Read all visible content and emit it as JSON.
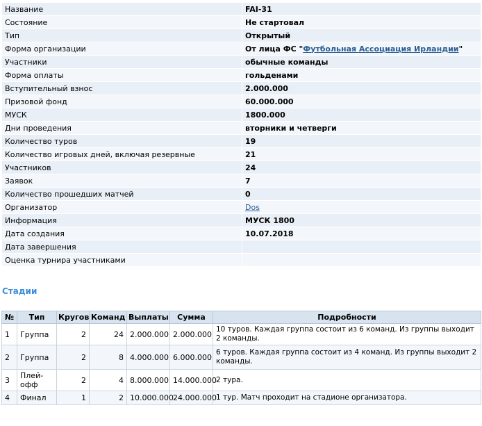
{
  "info": [
    {
      "label": "Название",
      "value": "FAI-31"
    },
    {
      "label": "Состояние",
      "value": "Не стартовал"
    },
    {
      "label": "Тип",
      "value": "Открытый"
    },
    {
      "label": "Форма организации",
      "value_prefix": "От лица ФС \"",
      "value_link": "Футбольная Ассоциация Ирландии",
      "value_suffix": "\""
    },
    {
      "label": "Участники",
      "value": "обычные команды"
    },
    {
      "label": "Форма оплаты",
      "value": "гольденами"
    },
    {
      "label": "Вступительный взнос",
      "value": "2.000.000"
    },
    {
      "label": "Призовой фонд",
      "value": "60.000.000"
    },
    {
      "label": "МУСК",
      "value": "1800.000"
    },
    {
      "label": "Дни проведения",
      "value": "вторники и четверги"
    },
    {
      "label": "Количество туров",
      "value": "19"
    },
    {
      "label": "Количество игровых дней, включая резервные",
      "value": "21"
    },
    {
      "label": "Участников",
      "value": "24"
    },
    {
      "label": "Заявок",
      "value": "7"
    },
    {
      "label": "Количество прошедших матчей",
      "value": "0"
    },
    {
      "label": "Организатор",
      "value_link": "Dos"
    },
    {
      "label": "Информация",
      "value": "МУСК 1800"
    },
    {
      "label": "Дата создания",
      "value": "10.07.2018"
    },
    {
      "label": "Дата завершения",
      "value": ""
    },
    {
      "label": "Оценка турнира участниками",
      "value": ""
    }
  ],
  "stages": {
    "title": "Стадии",
    "headers": [
      "№",
      "Тип",
      "Кругов",
      "Команд",
      "Выплаты",
      "Сумма",
      "Подробности"
    ],
    "rows": [
      [
        "1",
        "Группа",
        "2",
        "24",
        "2.000.000",
        "2.000.000",
        "10 туров. Каждая группа состоит из 6 команд. Из группы выходит 2 команды."
      ],
      [
        "2",
        "Группа",
        "2",
        "8",
        "4.000.000",
        "6.000.000",
        "6 туров. Каждая группа состоит из 4 команд. Из группы выходит 2 команды."
      ],
      [
        "3",
        "Плей-офф",
        "2",
        "4",
        "8.000.000",
        "14.000.000",
        "2 тура."
      ],
      [
        "4",
        "Финал",
        "1",
        "2",
        "10.000.000",
        "24.000.000",
        "1 тур. Матч проходит на стадионе организатора."
      ]
    ]
  }
}
